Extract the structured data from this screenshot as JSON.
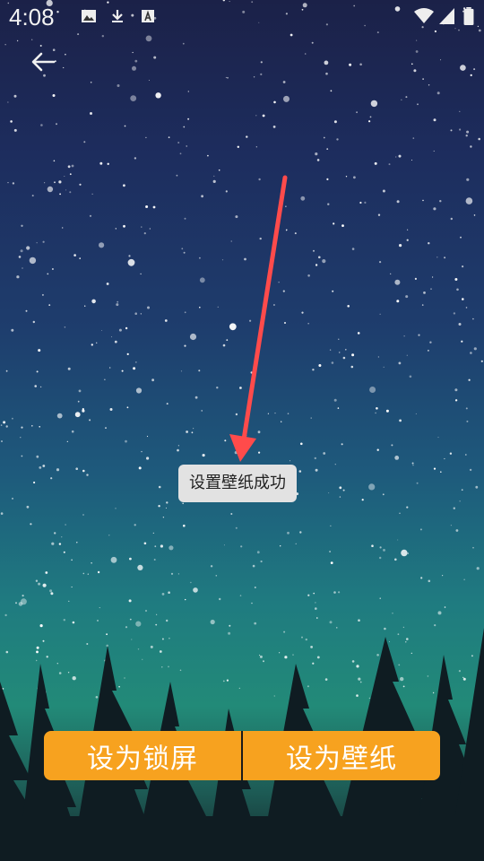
{
  "status_bar": {
    "time": "4:08",
    "icons_left": [
      "image-icon",
      "download-icon",
      "a-badge-icon"
    ],
    "icons_right": [
      "wifi-icon",
      "signal-icon",
      "battery-icon"
    ]
  },
  "toolbar": {
    "back_icon": "back-arrow-icon"
  },
  "toast": {
    "message": "设置壁纸成功"
  },
  "actions": {
    "set_lockscreen": "设为锁屏",
    "set_wallpaper": "设为壁纸"
  },
  "colors": {
    "accent": "#f7a21f",
    "annotation_arrow": "#ff4b4b",
    "toast_bg": "#e2e2e2"
  }
}
